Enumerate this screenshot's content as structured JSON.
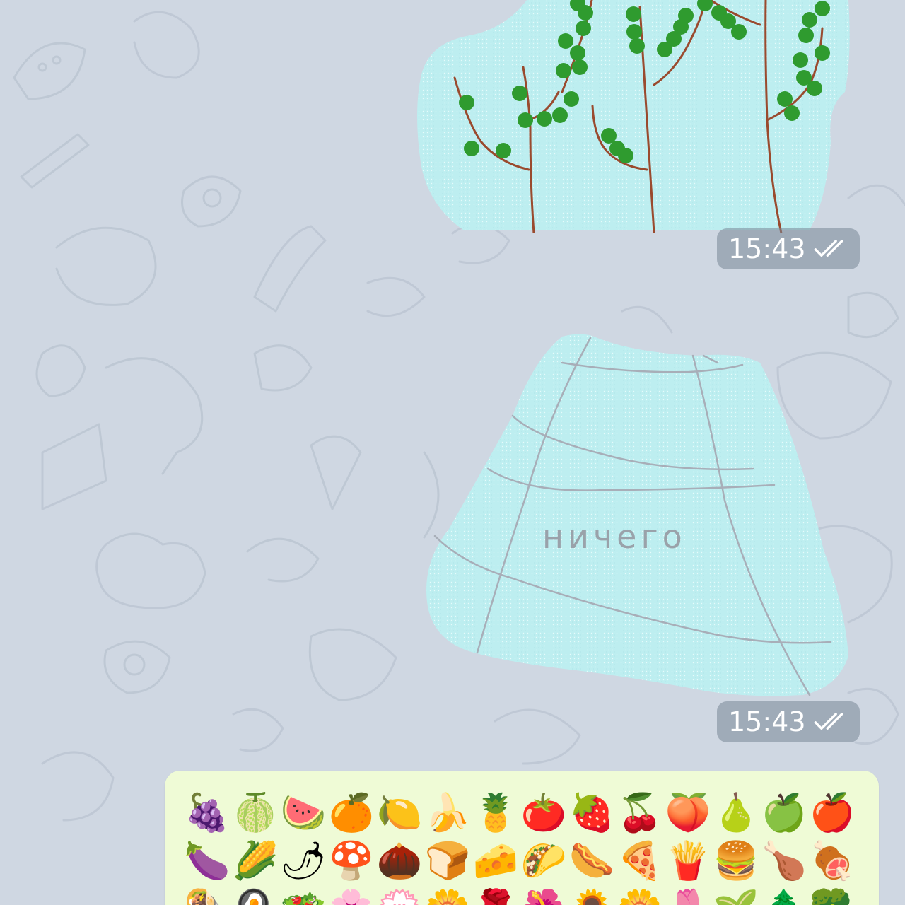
{
  "messages": [
    {
      "kind": "drawing-sticker",
      "subject": "trees",
      "time": "15:43",
      "status_icon": "double-check-icon"
    },
    {
      "kind": "drawing-sticker",
      "subject": "skirt",
      "sticker_text": "ничего",
      "time": "15:43",
      "status_icon": "double-check-icon"
    }
  ],
  "emoji_panel": {
    "rows": [
      [
        "🍇",
        "🍈",
        "🍉",
        "🍊",
        "🍋",
        "🍌",
        "🍍",
        "🍅",
        "🍓",
        "🍒",
        "🍑",
        "🍐",
        "🍏",
        "🍎"
      ],
      [
        "🍆",
        "🌽",
        "🌶",
        "🍄",
        "🌰",
        "🍞",
        "🧀",
        "🌮",
        "🌭",
        "🍕",
        "🍟",
        "🍔",
        "🍗",
        "🍖"
      ],
      [
        "🌯",
        "🍳",
        "🥗",
        "🌸",
        "💮",
        "🌼",
        "🌹",
        "🌺",
        "🌻",
        "🌼",
        "🌷",
        "🌱",
        "🌲",
        "🥦"
      ]
    ]
  },
  "colors": {
    "chat_background": "#cfd7e2",
    "sticker_fill": "#bdeef0",
    "tree_trunk": "#9a4a2e",
    "leaf": "#2f9b2f",
    "emoji_panel_bg": "#effbd6",
    "time_pill_bg": "#78869699"
  }
}
